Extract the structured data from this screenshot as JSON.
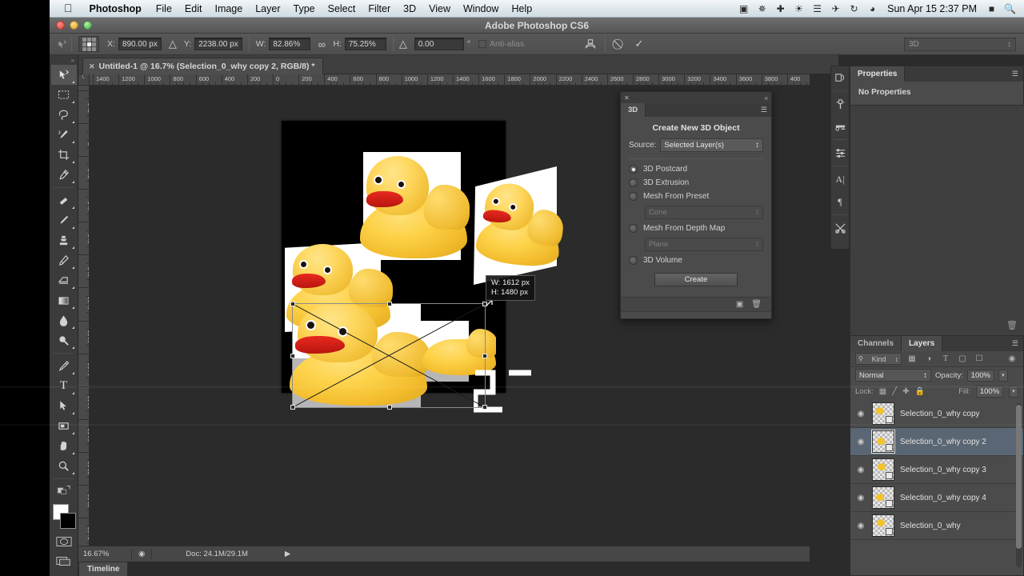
{
  "os_menu": {
    "apple_icon": "apple-icon",
    "app_name": "Photoshop",
    "items": [
      "File",
      "Edit",
      "Image",
      "Layer",
      "Type",
      "Select",
      "Filter",
      "3D",
      "View",
      "Window",
      "Help"
    ],
    "status_icons": [
      "screen-record-icon",
      "brightness-icon",
      "dropbox-icon",
      "globe-icon",
      "equalizer-icon",
      "evernote-icon",
      "sync-icon",
      "wifi-icon"
    ],
    "clock": "Sun Apr 15  2:37 PM",
    "battery_icon": "battery-icon",
    "search_icon": "search-icon"
  },
  "app_window": {
    "title": "Adobe Photoshop CS6"
  },
  "options_bar": {
    "tool_icon": "move-tool-icon",
    "reference_point_label": "reference-point-grid",
    "x_label": "X:",
    "x_value": "890.00 px",
    "delta_icon_1": "delta-icon",
    "y_label": "Y:",
    "y_value": "2238.00 px",
    "w_label": "W:",
    "w_value": "82.86%",
    "link_icon": "link-icon",
    "h_label": "H:",
    "h_value": "75.25%",
    "delta_icon_2": "angle-icon",
    "angle_value": "0.00",
    "degree": "°",
    "antialias_label": "Anti-alias",
    "warp_icon": "warp-icon",
    "cancel_icon": "cancel-icon",
    "commit_icon": "commit-icon",
    "workspace_value": "3D"
  },
  "document": {
    "tab_title": "Untitled-1 @ 16.7% (Selection_0_why copy 2, RGB/8) *",
    "close_icon": "close-icon",
    "ruler_h_labels": [
      "1400",
      "1200",
      "1000",
      "800",
      "600",
      "400",
      "200",
      "0",
      "200",
      "400",
      "600",
      "800",
      "1000",
      "1200",
      "1400",
      "1600",
      "1800",
      "2000",
      "2200",
      "2400",
      "2600",
      "2800",
      "3000",
      "3200",
      "3400",
      "3600",
      "3800",
      "400"
    ],
    "ruler_v_labels": [
      "200",
      "0",
      "200",
      "400",
      "600",
      "800",
      "1000",
      "1200",
      "1400",
      "1600",
      "1800",
      "2000",
      "2200",
      "2400"
    ],
    "transform_hud": {
      "width_line": "W: 1612 px",
      "height_line": "H: 1480 px"
    }
  },
  "status_bar": {
    "zoom": "16.67%",
    "preview_icon": "preview-icon",
    "doc_info": "Doc: 24.1M/29.1M",
    "arrow_icon": "play-arrow-icon"
  },
  "timeline": {
    "tab_label": "Timeline"
  },
  "tools": {
    "grip_icon": "panel-grip-icon",
    "items": [
      {
        "name": "move-tool",
        "icon": "move-tool-icon",
        "selected": true
      },
      {
        "name": "marquee-tool",
        "icon": "rectangular-marquee-icon",
        "selected": false
      },
      {
        "name": "lasso-tool",
        "icon": "lasso-icon",
        "selected": false
      },
      {
        "name": "quick-selection-tool",
        "icon": "magic-wand-icon",
        "selected": false
      },
      {
        "name": "crop-tool",
        "icon": "crop-icon",
        "selected": false
      },
      {
        "name": "eyedropper-tool",
        "icon": "eyedropper-icon",
        "selected": false
      },
      {
        "name": "healing-brush-tool",
        "icon": "healing-brush-icon",
        "selected": false
      },
      {
        "name": "brush-tool",
        "icon": "brush-icon",
        "selected": false
      },
      {
        "name": "clone-stamp-tool",
        "icon": "clone-stamp-icon",
        "selected": false
      },
      {
        "name": "history-brush-tool",
        "icon": "history-brush-icon",
        "selected": false
      },
      {
        "name": "eraser-tool",
        "icon": "eraser-icon",
        "selected": false
      },
      {
        "name": "gradient-tool",
        "icon": "gradient-icon",
        "selected": false
      },
      {
        "name": "blur-tool",
        "icon": "blur-drop-icon",
        "selected": false
      },
      {
        "name": "dodge-tool",
        "icon": "dodge-icon",
        "selected": false
      },
      {
        "name": "pen-tool",
        "icon": "pen-icon",
        "selected": false
      },
      {
        "name": "type-tool",
        "icon": "type-tool-icon",
        "selected": false
      },
      {
        "name": "path-selection-tool",
        "icon": "path-arrow-icon",
        "selected": false
      },
      {
        "name": "shape-tool",
        "icon": "rectangle-shape-icon",
        "selected": false
      },
      {
        "name": "hand-tool",
        "icon": "hand-icon",
        "selected": false
      },
      {
        "name": "zoom-tool",
        "icon": "zoom-magnifier-icon",
        "selected": false
      }
    ],
    "foreground_color": "#ffffff",
    "background_color": "#000000",
    "quick_mask_icon": "quick-mask-icon",
    "screen_mode_icon": "screen-mode-icon",
    "default_colors_icon": "default-colors-icon",
    "swap_colors_icon": "swap-colors-icon"
  },
  "panel_3d": {
    "close_icon": "close-icon",
    "collapse_icon": "collapse-icon",
    "tab_label": "3D",
    "menu_icon": "panel-menu-icon",
    "heading": "Create New 3D Object",
    "source_label": "Source:",
    "source_value": "Selected Layer(s)",
    "options": [
      {
        "label": "3D Postcard",
        "selected": true
      },
      {
        "label": "3D Extrusion",
        "selected": false
      },
      {
        "label": "Mesh From Preset",
        "selected": false
      },
      {
        "label": "Mesh From Depth Map",
        "selected": false
      },
      {
        "label": "3D Volume",
        "selected": false
      }
    ],
    "preset_value": "Cone",
    "depth_map_value": "Plane",
    "create_label": "Create",
    "footer_icons": [
      "new-3d-layer-icon",
      "delete-icon"
    ]
  },
  "icon_rail": {
    "items": [
      "history-icon",
      "color-icon",
      "swatches-icon",
      "adjustments-icon",
      "character-icon",
      "paragraph-icon",
      "tool-presets-icon"
    ]
  },
  "properties_panel": {
    "tab_label": "Properties",
    "menu_icon": "panel-menu-icon",
    "empty_text": "No Properties",
    "footer_icon": "delete-icon"
  },
  "layers_panel": {
    "tabs": [
      {
        "label": "Channels",
        "active": false
      },
      {
        "label": "Layers",
        "active": true
      }
    ],
    "menu_icon": "panel-menu-icon",
    "filter_label": "Kind",
    "filter_icon": "search-icon",
    "filter_type_icons": [
      "pixel-filter-icon",
      "adjustment-filter-icon",
      "type-filter-icon",
      "shape-filter-icon",
      "smartobject-filter-icon"
    ],
    "filter_toggle_icon": "filter-toggle-icon",
    "blend_mode": "Normal",
    "opacity_label": "Opacity:",
    "opacity_value": "100%",
    "lock_label": "Lock:",
    "lock_icons": [
      "lock-transparency-icon",
      "lock-image-icon",
      "lock-position-icon",
      "lock-all-icon"
    ],
    "fill_label": "Fill:",
    "fill_value": "100%",
    "layers": [
      {
        "name": "Selection_0_why copy",
        "visible": true,
        "selected": false
      },
      {
        "name": "Selection_0_why copy 2",
        "visible": true,
        "selected": true
      },
      {
        "name": "Selection_0_why copy 3",
        "visible": true,
        "selected": false
      },
      {
        "name": "Selection_0_why copy 4",
        "visible": true,
        "selected": false
      },
      {
        "name": "Selection_0_why",
        "visible": true,
        "selected": false
      }
    ],
    "eye_icon": "eye-icon"
  },
  "colors": {
    "panel_bg": "#4b4b4b",
    "dark_bg": "#2b2b2b",
    "canvas_bg": "#000000",
    "selection_blue": "#5a6673",
    "duck_yellow": "#f2c32b",
    "beak_red": "#cf1f17"
  }
}
